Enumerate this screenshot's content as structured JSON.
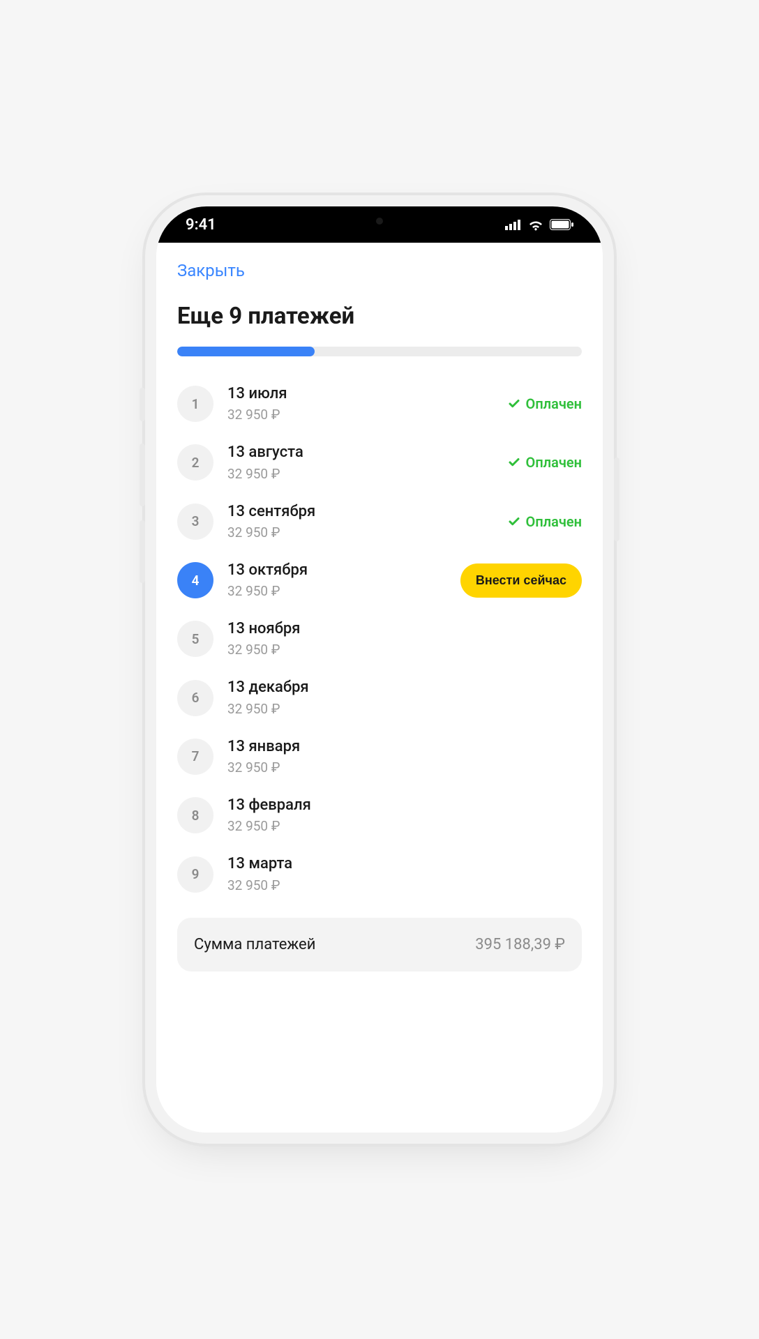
{
  "statusbar": {
    "time": "9:41"
  },
  "nav": {
    "close": "Закрыть"
  },
  "title": "Еще 9 платежей",
  "progress_pct": 34,
  "paid_label": "Оплачен",
  "pay_now_label": "Внести сейчас",
  "payments": [
    {
      "n": "1",
      "date": "13 июля",
      "amount": "32 950 ₽",
      "status": "paid"
    },
    {
      "n": "2",
      "date": "13 августа",
      "amount": "32 950 ₽",
      "status": "paid"
    },
    {
      "n": "3",
      "date": "13 сентября",
      "amount": "32 950 ₽",
      "status": "paid"
    },
    {
      "n": "4",
      "date": "13 октября",
      "amount": "32 950 ₽",
      "status": "current"
    },
    {
      "n": "5",
      "date": "13 ноября",
      "amount": "32 950 ₽",
      "status": "upcoming"
    },
    {
      "n": "6",
      "date": "13 декабря",
      "amount": "32 950 ₽",
      "status": "upcoming"
    },
    {
      "n": "7",
      "date": "13 января",
      "amount": "32 950 ₽",
      "status": "upcoming"
    },
    {
      "n": "8",
      "date": "13 февраля",
      "amount": "32 950 ₽",
      "status": "upcoming"
    },
    {
      "n": "9",
      "date": "13 марта",
      "amount": "32 950 ₽",
      "status": "upcoming"
    }
  ],
  "summary": {
    "label": "Сумма платежей",
    "value": "395 188,39 ₽"
  }
}
